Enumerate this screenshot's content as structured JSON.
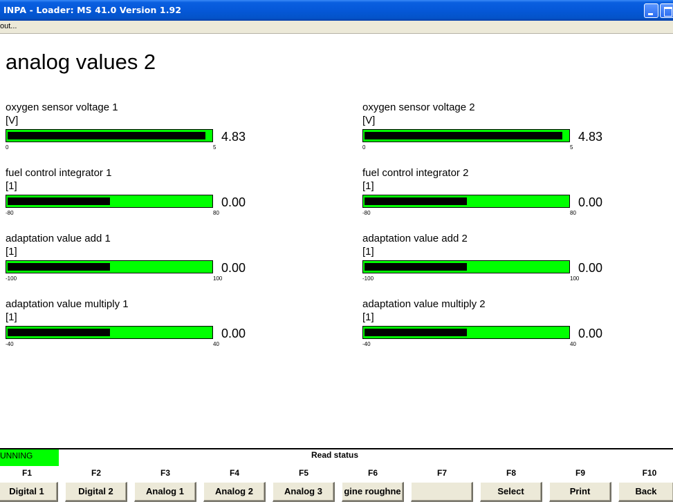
{
  "window": {
    "title": "INPA - Loader:  MS 41.0 Version 1.92"
  },
  "menubar": {
    "item": "out..."
  },
  "page": {
    "title": "analog values 2"
  },
  "gauges": [
    {
      "label": "oxygen sensor voltage  1",
      "unit": "[V]",
      "value": "4.83",
      "min": "0",
      "max": "5",
      "level": 0.966
    },
    {
      "label": "oxygen sensor voltage  2",
      "unit": "[V]",
      "value": "4.83",
      "min": "0",
      "max": "5",
      "level": 0.966
    },
    {
      "label": "fuel control integrator 1",
      "unit": "[1]",
      "value": "0.00",
      "min": "-80",
      "max": "80",
      "level": 0.5
    },
    {
      "label": "fuel control integrator 2",
      "unit": "[1]",
      "value": "0.00",
      "min": "-80",
      "max": "80",
      "level": 0.5
    },
    {
      "label": "adaptation value add 1",
      "unit": "[1]",
      "value": "0.00",
      "min": "-100",
      "max": "100",
      "level": 0.5
    },
    {
      "label": "adaptation value add 2",
      "unit": "[1]",
      "value": "0.00",
      "min": "-100",
      "max": "100",
      "level": 0.5
    },
    {
      "label": "adaptation value multiply 1",
      "unit": "[1]",
      "value": "0.00",
      "min": "-40",
      "max": "40",
      "level": 0.5
    },
    {
      "label": "adaptation value multiply 2",
      "unit": "[1]",
      "value": "0.00",
      "min": "-40",
      "max": "40",
      "level": 0.5
    }
  ],
  "status": {
    "running": "UNNING",
    "text": "Read status"
  },
  "function_keys": [
    {
      "key": "F1",
      "label": "Digital 1"
    },
    {
      "key": "F2",
      "label": "Digital 2"
    },
    {
      "key": "F3",
      "label": "Analog 1"
    },
    {
      "key": "F4",
      "label": "Analog 2"
    },
    {
      "key": "F5",
      "label": "Analog 3"
    },
    {
      "key": "F6",
      "label": "gine roughne"
    },
    {
      "key": "F7",
      "label": ""
    },
    {
      "key": "F8",
      "label": "Select"
    },
    {
      "key": "F9",
      "label": "Print"
    },
    {
      "key": "F10",
      "label": "Back"
    }
  ],
  "colors": {
    "bar_background": "#00ff00",
    "bar_fill": "#000000",
    "titlebar": "#0558d8",
    "running": "#00ff00"
  }
}
